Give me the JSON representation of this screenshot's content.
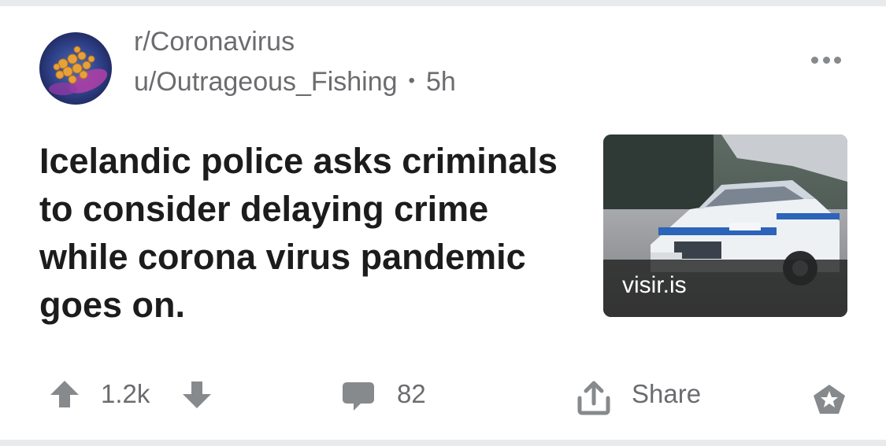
{
  "post": {
    "subreddit": "r/Coronavirus",
    "author": "u/Outrageous_Fishing",
    "separator": "•",
    "age": "5h",
    "title": "Icelandic police asks criminals to consider delaying crime while corona virus pandemic goes on.",
    "thumbnail": {
      "domain": "visir.is",
      "icon": "police-car-photo"
    }
  },
  "actions": {
    "upvote_icon": "arrow-up-icon",
    "score": "1.2k",
    "downvote_icon": "arrow-down-icon",
    "comment_icon": "comment-icon",
    "comments": "82",
    "share_icon": "share-icon",
    "share_label": "Share",
    "award_icon": "award-icon"
  },
  "colors": {
    "background": "#ffffff",
    "page_background": "#e9eaec",
    "title_text": "#1c1c1c",
    "meta_text": "#6b6c6f",
    "icon_gray": "#878a8c"
  }
}
